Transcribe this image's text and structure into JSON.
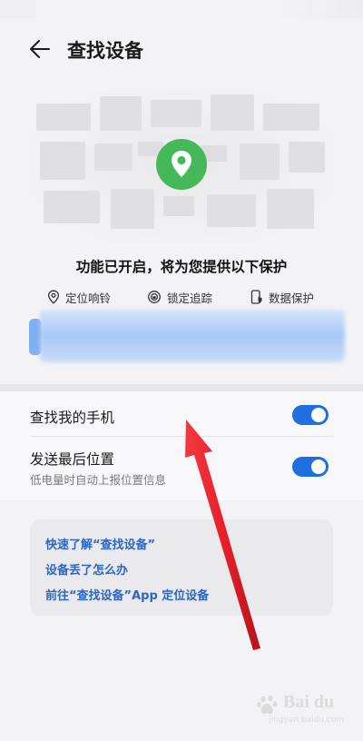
{
  "header": {
    "title": "查找设备",
    "back_icon": "arrow-left-icon"
  },
  "map": {
    "pin_icon": "location-pin-icon",
    "pin_color": "#45b85a"
  },
  "protection": {
    "headline": "功能已开启，将为您提供以下保护",
    "features": [
      {
        "label": "定位响铃",
        "icon": "location-ring-icon"
      },
      {
        "label": "锁定追踪",
        "icon": "lock-track-icon"
      },
      {
        "label": "数据保护",
        "icon": "phone-shield-icon"
      }
    ]
  },
  "settings": {
    "find_my_phone": {
      "label": "查找我的手机",
      "enabled": true
    },
    "send_last_location": {
      "label": "发送最后位置",
      "sublabel": "低电量时自动上报位置信息",
      "enabled": true
    }
  },
  "links": [
    "快速了解“查找设备”",
    "设备丢了怎么办",
    "前往“查找设备”App 定位设备"
  ],
  "colors": {
    "accent": "#1f6fe0",
    "link": "#2b66c6",
    "annotation_arrow": "#e8202a"
  }
}
